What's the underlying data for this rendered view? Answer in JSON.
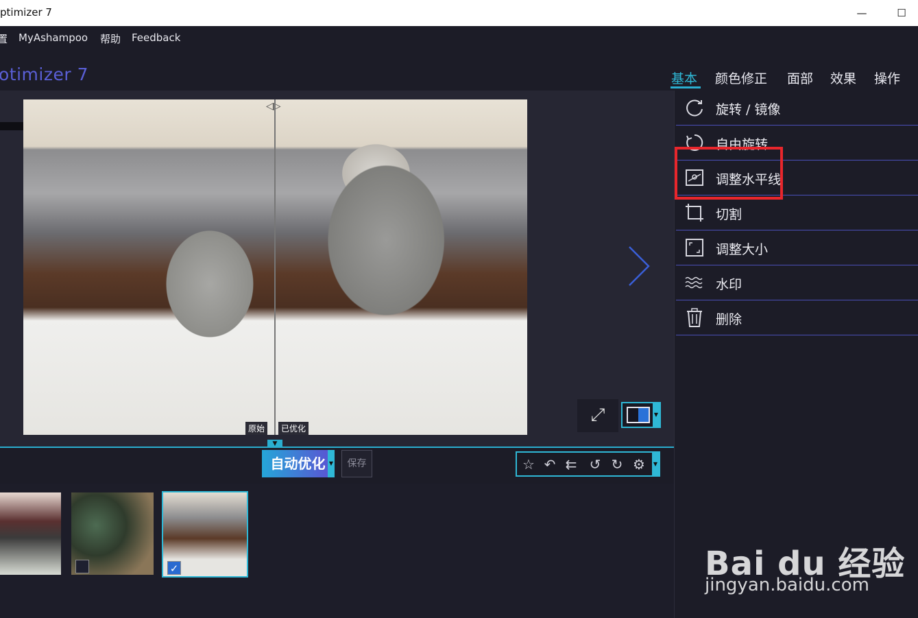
{
  "titlebar": {
    "title": "ptimizer 7",
    "minimize": "—",
    "maximize": "☐"
  },
  "menu": {
    "items": [
      "置",
      "MyAshampoo",
      "帮助",
      "Feedback"
    ]
  },
  "header": {
    "app_title": "otimizer 7",
    "tabs": [
      "基本",
      "颜色修正",
      "面部",
      "效果",
      "操作"
    ],
    "active_tab": "基本"
  },
  "viewer": {
    "label_original": "原始",
    "label_optimized": "已优化",
    "split_arrows": "◁▷"
  },
  "toolbar": {
    "auto_optimize": "自动优化",
    "save": "保存"
  },
  "right_panel": {
    "items": [
      "旋转 / 镜像",
      "自由旋转",
      "调整水平线",
      "切割",
      "调整大小",
      "水印",
      "删除"
    ]
  },
  "filmstrip": {
    "checked_index": 2
  },
  "watermark": {
    "brand": "Bai du 经验",
    "url": "jingyan.baidu.com"
  },
  "colors": {
    "accent": "#2fb8d6",
    "app_title": "#5a5fd6",
    "highlight": "#e8262c",
    "divider": "#4a4fb8"
  }
}
